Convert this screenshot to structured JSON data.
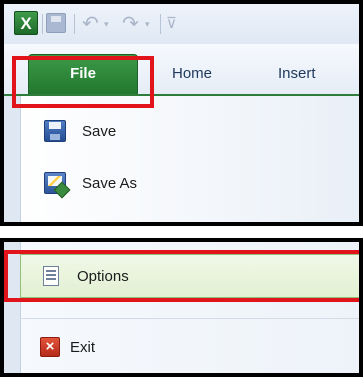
{
  "quick_access": {
    "app_icon_letter": "X",
    "undo_glyph": "↶",
    "redo_glyph": "↷",
    "caret": "▾",
    "customize_glyph": "⊽"
  },
  "tabs": {
    "file": "File",
    "items": [
      "Home",
      "Insert"
    ]
  },
  "file_menu": {
    "save": "Save",
    "save_as": "Save As",
    "options": "Options",
    "exit": "Exit"
  },
  "icons": {
    "app": "excel-icon",
    "quick_save": "save-icon",
    "undo": "undo-icon",
    "redo": "redo-icon",
    "save": "save-icon",
    "save_as": "save-as-icon",
    "options": "options-icon",
    "exit": "exit-icon"
  },
  "colors": {
    "file_tab": "#2f8a3b",
    "highlight_border": "#e1141c",
    "options_hover": "#e2f0d2",
    "exit_icon": "#c8371f"
  }
}
